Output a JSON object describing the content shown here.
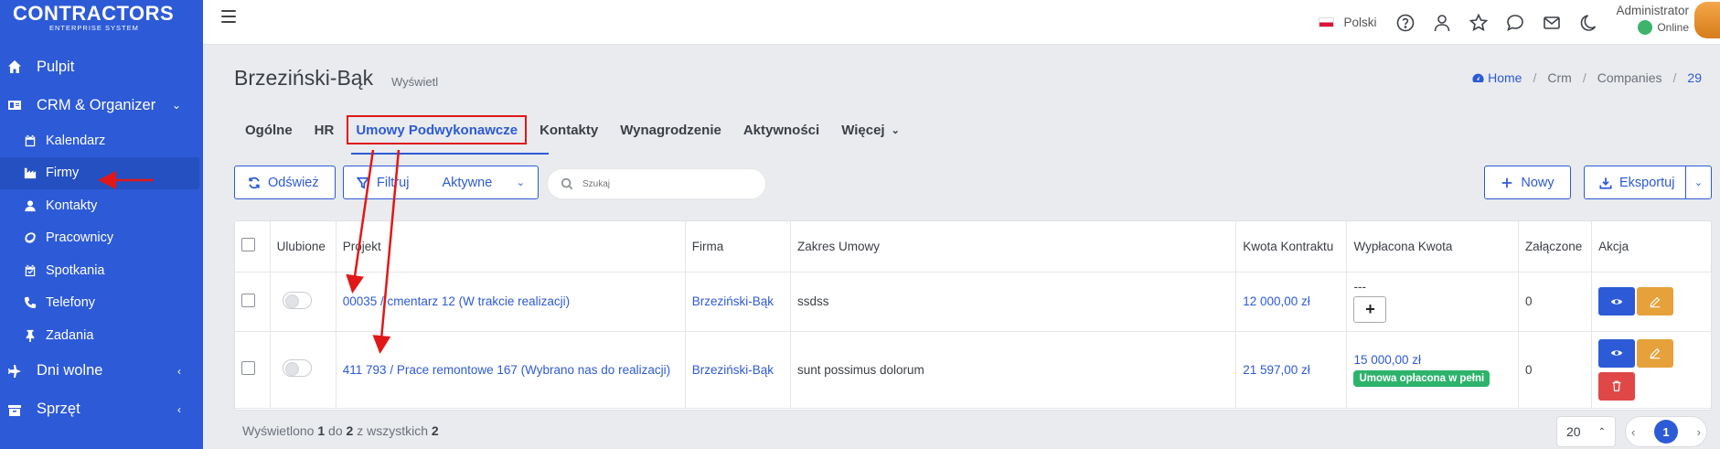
{
  "brand": {
    "name": "CONTRACTORS",
    "tagline": "ENTERPRISE SYSTEM"
  },
  "sidebar": {
    "items": [
      {
        "label": "Pulpit",
        "icon": "home-icon"
      },
      {
        "label": "CRM & Organizer",
        "icon": "id-card-icon"
      },
      {
        "label": "Kalendarz",
        "icon": "calendar-icon"
      },
      {
        "label": "Firmy",
        "icon": "factory-icon",
        "active": true
      },
      {
        "label": "Kontakty",
        "icon": "user-icon"
      },
      {
        "label": "Pracownicy",
        "icon": "lemon-icon"
      },
      {
        "label": "Spotkania",
        "icon": "calendar-check-icon"
      },
      {
        "label": "Telefony",
        "icon": "phone-icon"
      },
      {
        "label": "Zadania",
        "icon": "thumbtack-icon"
      },
      {
        "label": "Dni wolne",
        "icon": "plane-icon"
      },
      {
        "label": "Sprzęt",
        "icon": "box-icon"
      }
    ]
  },
  "header": {
    "language": "Polski",
    "user_name": "Administrator",
    "user_status": "Online"
  },
  "page": {
    "title": "Brzeziński-Bąk",
    "subtitle": "Wyświetl",
    "breadcrumb": [
      "Home",
      "Crm",
      "Companies",
      "29"
    ]
  },
  "tabs": [
    "Ogólne",
    "HR",
    "Umowy Podwykonawcze",
    "Kontakty",
    "Wynagrodzenie",
    "Aktywności",
    "Więcej"
  ],
  "toolbar": {
    "refresh_label": "Odśwież",
    "filter_label": "Filtruj",
    "filter_value": "Aktywne",
    "search_placeholder": "Szukaj",
    "new_label": "Nowy",
    "export_label": "Eksportuj"
  },
  "table": {
    "headers": [
      "",
      "Ulubione",
      "Projekt",
      "Firma",
      "Zakres Umowy",
      "Kwota Kontraktu",
      "Wypłacona Kwota",
      "Załączone",
      "Akcja"
    ],
    "rows": [
      {
        "project": "00035 / cmentarz 12 (W trakcie realizacji)",
        "company": "Brzeziński-Bąk",
        "scope": "ssdss",
        "amount": "12 000,00 zł",
        "paid": "---",
        "attached": "0"
      },
      {
        "project": "411 793 / Prace remontowe 167 (Wybrano nas do realizacji)",
        "company": "Brzeziński-Bąk",
        "scope": "sunt possimus dolorum",
        "amount": "21 597,00 zł",
        "paid": "15 000,00 zł",
        "paid_badge": "Umowa opłacona w pełni",
        "attached": "0"
      }
    ]
  },
  "footer": {
    "shown_prefix": "Wyświetlono",
    "from": "1",
    "to_word": "do",
    "to": "2",
    "of_word": "z wszystkich",
    "total": "2",
    "page_size": "20",
    "current_page": "1"
  },
  "colors": {
    "primary": "#2d5ad6",
    "sidebar": "#2d5ad6",
    "annotation": "#e01818",
    "success": "#2db36b",
    "warning": "#e6a13a",
    "danger": "#e04848"
  }
}
